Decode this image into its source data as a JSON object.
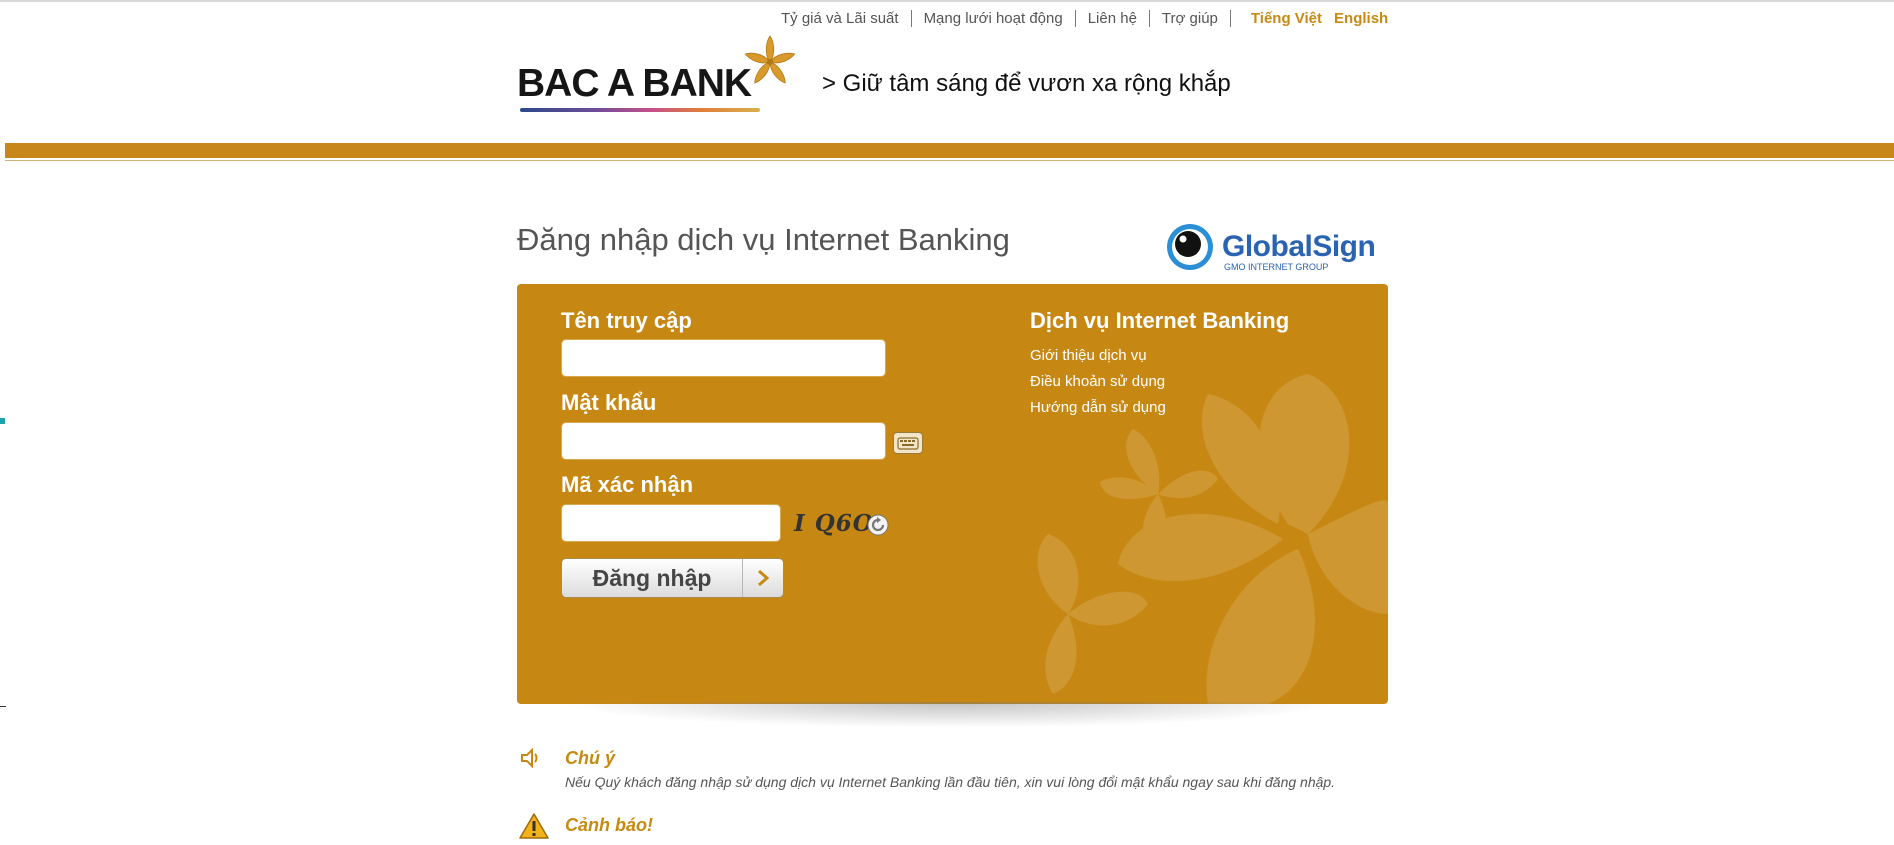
{
  "top_links": [
    "Tỷ giá và Lãi suất",
    "Mạng lưới hoạt động",
    "Liên hệ",
    "Trợ giúp"
  ],
  "languages": {
    "vietnamese": "Tiếng Việt",
    "english": "English"
  },
  "brand": {
    "name": "BAC A BANK",
    "slogan": "> Giữ tâm sáng để vươn xa rộng khắp",
    "accent_color": "#c8871a"
  },
  "page_title": "Đăng nhập dịch vụ Internet Banking",
  "globalsign": {
    "name": "GlobalSign",
    "subtitle": "GMO INTERNET GROUP"
  },
  "login": {
    "username_label": "Tên truy cập",
    "username_value": "",
    "password_label": "Mật khẩu",
    "password_value": "",
    "captcha_label": "Mã xác nhận",
    "captcha_value": "",
    "captcha_image_text": "I Q6O",
    "submit_label": "Đăng nhập"
  },
  "services": {
    "title": "Dịch vụ Internet Banking",
    "links": [
      "Giới thiệu dịch vụ",
      "Điều khoản sử dụng",
      "Hướng dẫn sử dụng"
    ]
  },
  "notice": {
    "title": "Chú ý",
    "text": "Nếu Quý khách đăng nhập sử dụng dịch vụ Internet Banking lần đầu tiên, xin vui lòng đổi mật khẩu ngay sau khi đăng nhập."
  },
  "warning": {
    "title": "Cảnh báo!"
  },
  "icons": {
    "keyboard": "virtual-keyboard-icon",
    "refresh": "refresh-captcha-icon",
    "arrow": "chevron-right-icon",
    "speaker": "speaker-icon",
    "warning": "warning-triangle-icon"
  }
}
